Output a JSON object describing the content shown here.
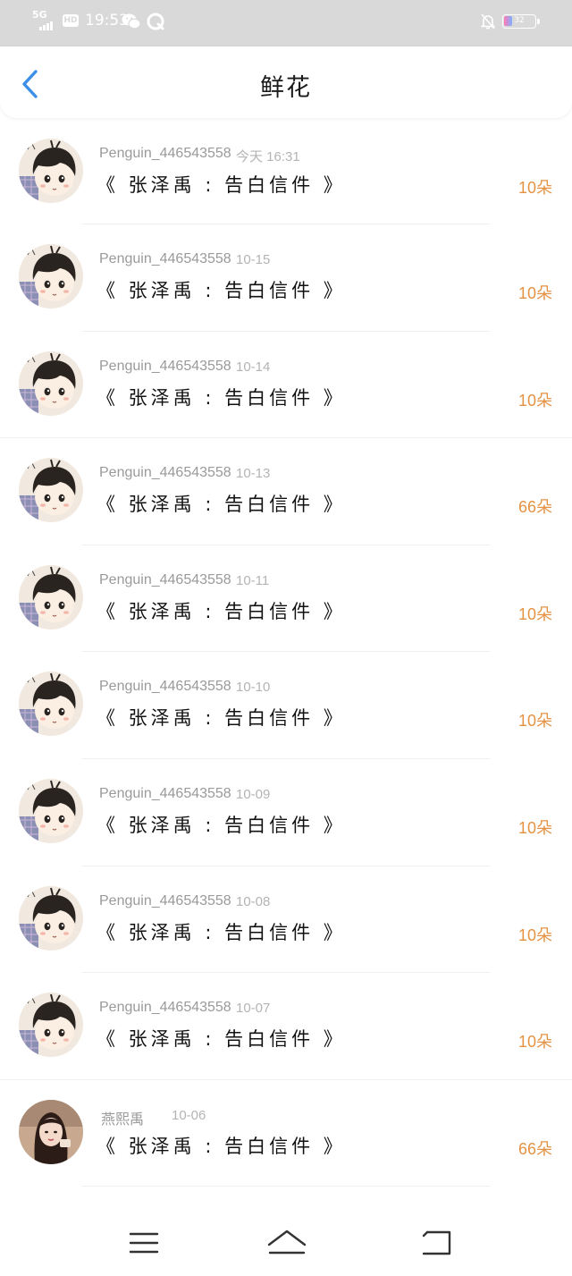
{
  "status_bar": {
    "network": "5G",
    "hd": "HD",
    "time": "19:53",
    "battery": "32",
    "icons": [
      "signal-icon",
      "wechat-icon",
      "qq-icon",
      "mute-bell-icon",
      "battery-icon"
    ]
  },
  "header": {
    "title": "鲜花",
    "back_icon": "chevron-left-icon",
    "accent_color": "#3b8fe6"
  },
  "records": [
    {
      "username": "Penguin_446543558",
      "date": "今天 16:31",
      "gift": "《 张泽禹 : 告白信件 》",
      "count": "10朵",
      "avatar": "avatar-boy-icon"
    },
    {
      "username": "Penguin_446543558",
      "date": "10-15",
      "gift": "《 张泽禹 : 告白信件 》",
      "count": "10朵",
      "avatar": "avatar-boy-icon"
    },
    {
      "username": "Penguin_446543558",
      "date": "10-14",
      "gift": "《 张泽禹 : 告白信件 》",
      "count": "10朵",
      "avatar": "avatar-boy-icon"
    },
    {
      "username": "Penguin_446543558",
      "date": "10-13",
      "gift": "《 张泽禹 : 告白信件 》",
      "count": "66朵",
      "avatar": "avatar-boy-icon"
    },
    {
      "username": "Penguin_446543558",
      "date": "10-11",
      "gift": "《 张泽禹 : 告白信件 》",
      "count": "10朵",
      "avatar": "avatar-boy-icon"
    },
    {
      "username": "Penguin_446543558",
      "date": "10-10",
      "gift": "《 张泽禹 : 告白信件 》",
      "count": "10朵",
      "avatar": "avatar-boy-icon"
    },
    {
      "username": "Penguin_446543558",
      "date": "10-09",
      "gift": "《 张泽禹 : 告白信件 》",
      "count": "10朵",
      "avatar": "avatar-boy-icon"
    },
    {
      "username": "Penguin_446543558",
      "date": "10-08",
      "gift": "《 张泽禹 : 告白信件 》",
      "count": "10朵",
      "avatar": "avatar-boy-icon"
    },
    {
      "username": "Penguin_446543558",
      "date": "10-07",
      "gift": "《 张泽禹 : 告白信件 》",
      "count": "10朵",
      "avatar": "avatar-boy-icon"
    },
    {
      "username": "燕熙禹",
      "date": "10-06",
      "gift": "《 张泽禹 : 告白信件 》",
      "count": "66朵",
      "avatar": "avatar-girl-photo-icon"
    }
  ],
  "count_color": "#e49344",
  "bottom_nav": {
    "icons": [
      "menu-icon",
      "home-icon",
      "back-icon"
    ]
  }
}
